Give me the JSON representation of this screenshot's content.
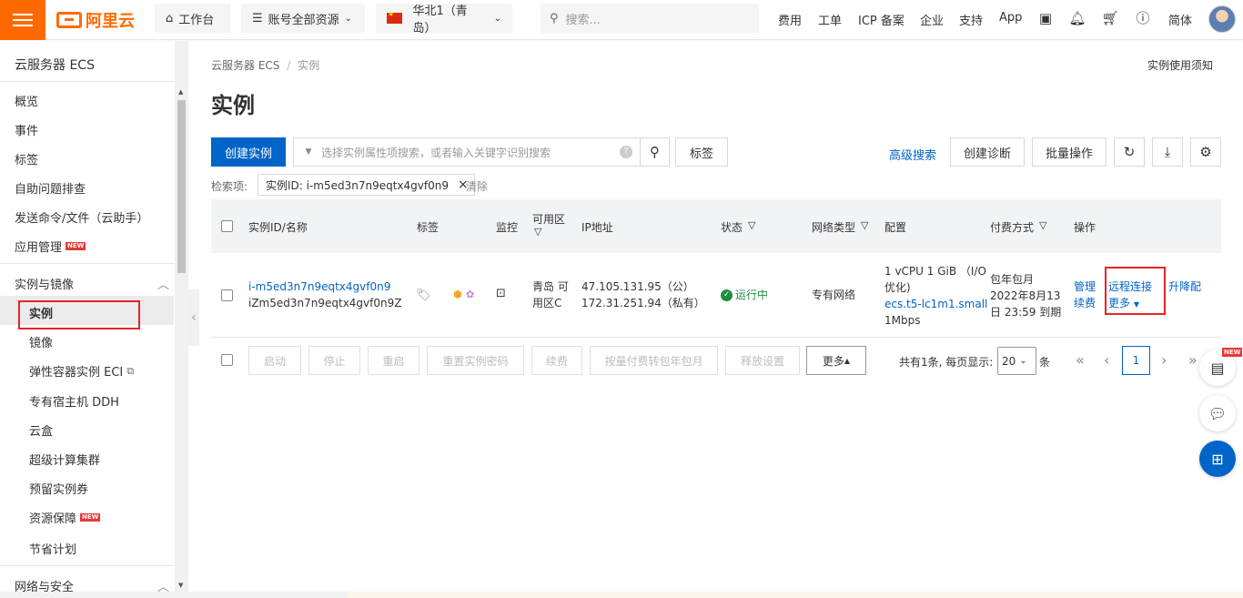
{
  "topbar": {
    "logo_text": "阿里云",
    "workbench": "工作台",
    "resources": "账号全部资源",
    "region": "华北1（青岛）",
    "search_placeholder": "搜索...",
    "links": [
      "费用",
      "工单",
      "ICP 备案",
      "企业",
      "支持",
      "App"
    ],
    "lang": "简体"
  },
  "sidebar": {
    "title": "云服务器 ECS",
    "items": [
      "概览",
      "事件",
      "标签",
      "自助问题排查",
      "发送命令/文件（云助手）",
      "应用管理"
    ],
    "new_badge": "NEW",
    "group1": "实例与镜像",
    "subitems": [
      "实例",
      "镜像",
      "弹性容器实例 ECI",
      "专有宿主机 DDH",
      "云盒",
      "超级计算集群",
      "预留实例券",
      "资源保障",
      "节省计划"
    ],
    "group2": "网络与安全"
  },
  "main": {
    "breadcrumb_root": "云服务器 ECS",
    "breadcrumb_sep": "/",
    "breadcrumb_current": "实例",
    "notice": "实例使用须知",
    "title": "实例",
    "create_button": "创建实例",
    "search_placeholder": "选择实例属性项搜索，或者输入关键字识别搜索",
    "tag_button": "标签",
    "advanced_search": "高级搜索",
    "create_diagnosis": "创建诊断",
    "batch_ops": "批量操作",
    "filter_label": "检索项:",
    "filter_chip": "实例ID: i-m5ed3n7n9eqtx4gvf0n9",
    "clear": "清除"
  },
  "table": {
    "headers": {
      "id": "实例ID/名称",
      "tags": "标签",
      "monitor": "监控",
      "zone": "可用区",
      "ip": "IP地址",
      "status": "状态",
      "network": "网络类型",
      "config": "配置",
      "billing": "付费方式",
      "actions": "操作"
    },
    "row": {
      "id": "i-m5ed3n7n9eqtx4gvf0n9",
      "name": "iZm5ed3n7n9eqtx4gvf0n9Z",
      "zone_line1": "青岛 可",
      "zone_line2": "用区C",
      "ip_public": "47.105.131.95（公）",
      "ip_private": "172.31.251.94（私有）",
      "status": "运行中",
      "network": "专有网络",
      "config_line1": "1 vCPU 1 GiB （I/O",
      "config_line2": "优化)",
      "config_type": "ecs.t5-lc1m1.small",
      "config_bw": "1Mbps",
      "billing_line1": "包年包月",
      "billing_line2": "2022年8月13",
      "billing_line3": "日 23:59 到期",
      "action_manage": "管理",
      "action_renew": "续费",
      "action_remote": "远程连接",
      "action_more": "更多",
      "action_upgrade": "升降配"
    }
  },
  "bottom_actions": [
    "启动",
    "停止",
    "重启",
    "重置实例密码",
    "续费",
    "按量付费转包年包月",
    "释放设置",
    "更多"
  ],
  "pagination": {
    "summary": "共有1条, 每页显示:",
    "page_size": "20",
    "unit": "条",
    "current": "1"
  },
  "float_new": "NEW",
  "colors": {
    "brand": "#ff6a00",
    "primary": "#0064c8",
    "success": "#1e8e3e",
    "highlight": "#e6242a"
  }
}
